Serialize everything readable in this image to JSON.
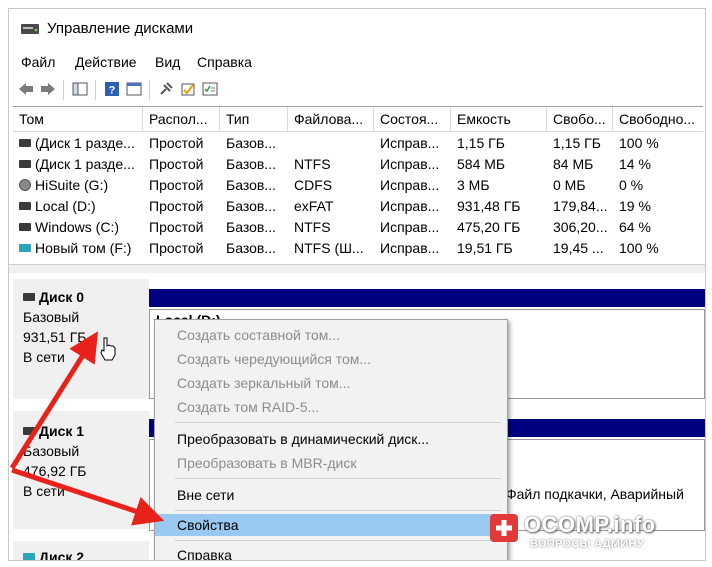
{
  "window": {
    "title": "Управление дисками"
  },
  "menu": [
    "Файл",
    "Действие",
    "Вид",
    "Справка"
  ],
  "toolbar": [
    "back-icon",
    "forward-icon",
    "console-tree-icon",
    "help-icon",
    "pin-icon",
    "disk-properties-icon",
    "checklist-icon"
  ],
  "volumes": {
    "columns": [
      "Том",
      "Располо...",
      "Тип",
      "Файловая...",
      "Состоя...",
      "Емкость",
      "Своб...",
      "Свободно..."
    ],
    "columns_display": [
      "Том",
      "Распол...",
      "Тип",
      "Файлова...",
      "Состоя...",
      "Емкость",
      "Свобо...",
      "Свободно..."
    ],
    "rows": [
      {
        "icon": "disk-icon",
        "name": "(Диск 1 разде...",
        "layout": "Простой",
        "type": "Базов...",
        "fs": "",
        "status": "Исправ...",
        "capacity": "1,15 ГБ",
        "free": "1,15 ГБ",
        "free_pct": "100 %"
      },
      {
        "icon": "disk-icon",
        "name": "(Диск 1 разде...",
        "layout": "Простой",
        "type": "Базов...",
        "fs": "NTFS",
        "status": "Исправ...",
        "capacity": "584 МБ",
        "free": "84 МБ",
        "free_pct": "14 %"
      },
      {
        "icon": "cd-icon",
        "name": "HiSuite (G:)",
        "layout": "Простой",
        "type": "Базов...",
        "fs": "CDFS",
        "status": "Исправ...",
        "capacity": "3 МБ",
        "free": "0 МБ",
        "free_pct": "0 %"
      },
      {
        "icon": "disk-icon",
        "name": "Local (D:)",
        "layout": "Простой",
        "type": "Базов...",
        "fs": "exFAT",
        "status": "Исправ...",
        "capacity": "931,48 ГБ",
        "free": "179,84...",
        "free_pct": "19 %"
      },
      {
        "icon": "disk-icon",
        "name": "Windows (C:)",
        "layout": "Простой",
        "type": "Базов...",
        "fs": "NTFS",
        "status": "Исправ...",
        "capacity": "475,20 ГБ",
        "free": "306,20...",
        "free_pct": "64 %"
      },
      {
        "icon": "usb-disk-icon",
        "name": "Новый том (F:)",
        "layout": "Простой",
        "type": "Базов...",
        "fs": "NTFS (Ш...",
        "status": "Исправ...",
        "capacity": "19,51 ГБ",
        "free": "19,45 ...",
        "free_pct": "100 %"
      }
    ]
  },
  "disks": [
    {
      "name": "Диск 0",
      "type": "Базовый",
      "size": "931,51 ГБ",
      "status": "В сети",
      "volume_label": "Local (D:)"
    },
    {
      "name": "Диск 1",
      "type": "Базовый",
      "size": "476,92 ГБ",
      "status": "В сети",
      "volume_info": "Файл подкачки, Аварийный"
    },
    {
      "name": "Диск 2"
    }
  ],
  "context_menu": [
    {
      "label": "Создать составной том...",
      "enabled": false
    },
    {
      "label": "Создать чередующийся том...",
      "enabled": false
    },
    {
      "label": "Создать зеркальный том...",
      "enabled": false
    },
    {
      "label": "Создать том RAID-5...",
      "enabled": false
    },
    {
      "label": "Преобразовать в динамический диск...",
      "enabled": true
    },
    {
      "label": "Преобразовать в MBR-диск",
      "enabled": false
    },
    {
      "label": "Вне сети",
      "enabled": true
    },
    {
      "label": "Свойства",
      "enabled": true,
      "highlighted": true
    },
    {
      "label": "Справка",
      "enabled": true
    }
  ],
  "watermark": {
    "main": "OCOMP.info",
    "sub": "ВОПРОСЫ АДМИНУ"
  },
  "colors": {
    "highlight": "#99c9f1",
    "disk_bar": "#000080",
    "arrow": "#e8221b"
  }
}
